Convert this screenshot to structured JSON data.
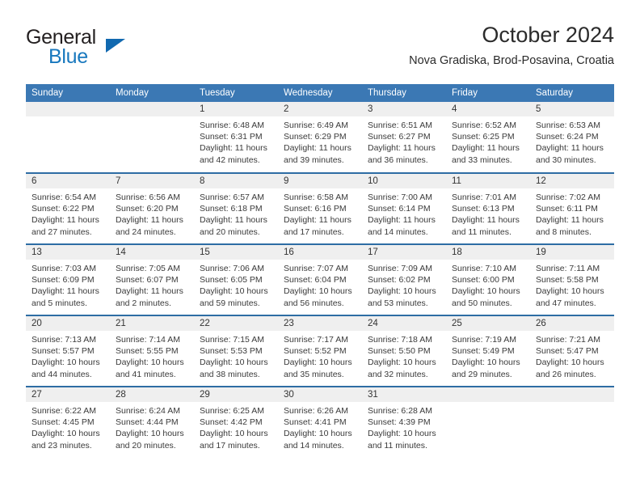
{
  "brand": {
    "line1": "General",
    "line2": "Blue",
    "triangle_icon": "triangle-icon"
  },
  "header": {
    "title": "October 2024",
    "subtitle": "Nova Gradiska, Brod-Posavina, Croatia"
  },
  "colors": {
    "header_blue": "#3b78b4",
    "rule_blue": "#2e6da4",
    "daynum_bg": "#efefef",
    "brand_blue": "#1878be",
    "text": "#333333"
  },
  "weekday_headers": [
    "Sunday",
    "Monday",
    "Tuesday",
    "Wednesday",
    "Thursday",
    "Friday",
    "Saturday"
  ],
  "weeks": [
    [
      {
        "day": "",
        "empty": true,
        "sunrise": "",
        "sunset": "",
        "daylight": ""
      },
      {
        "day": "",
        "empty": true,
        "sunrise": "",
        "sunset": "",
        "daylight": ""
      },
      {
        "day": "1",
        "sunrise": "Sunrise: 6:48 AM",
        "sunset": "Sunset: 6:31 PM",
        "daylight": "Daylight: 11 hours and 42 minutes."
      },
      {
        "day": "2",
        "sunrise": "Sunrise: 6:49 AM",
        "sunset": "Sunset: 6:29 PM",
        "daylight": "Daylight: 11 hours and 39 minutes."
      },
      {
        "day": "3",
        "sunrise": "Sunrise: 6:51 AM",
        "sunset": "Sunset: 6:27 PM",
        "daylight": "Daylight: 11 hours and 36 minutes."
      },
      {
        "day": "4",
        "sunrise": "Sunrise: 6:52 AM",
        "sunset": "Sunset: 6:25 PM",
        "daylight": "Daylight: 11 hours and 33 minutes."
      },
      {
        "day": "5",
        "sunrise": "Sunrise: 6:53 AM",
        "sunset": "Sunset: 6:24 PM",
        "daylight": "Daylight: 11 hours and 30 minutes."
      }
    ],
    [
      {
        "day": "6",
        "sunrise": "Sunrise: 6:54 AM",
        "sunset": "Sunset: 6:22 PM",
        "daylight": "Daylight: 11 hours and 27 minutes."
      },
      {
        "day": "7",
        "sunrise": "Sunrise: 6:56 AM",
        "sunset": "Sunset: 6:20 PM",
        "daylight": "Daylight: 11 hours and 24 minutes."
      },
      {
        "day": "8",
        "sunrise": "Sunrise: 6:57 AM",
        "sunset": "Sunset: 6:18 PM",
        "daylight": "Daylight: 11 hours and 20 minutes."
      },
      {
        "day": "9",
        "sunrise": "Sunrise: 6:58 AM",
        "sunset": "Sunset: 6:16 PM",
        "daylight": "Daylight: 11 hours and 17 minutes."
      },
      {
        "day": "10",
        "sunrise": "Sunrise: 7:00 AM",
        "sunset": "Sunset: 6:14 PM",
        "daylight": "Daylight: 11 hours and 14 minutes."
      },
      {
        "day": "11",
        "sunrise": "Sunrise: 7:01 AM",
        "sunset": "Sunset: 6:13 PM",
        "daylight": "Daylight: 11 hours and 11 minutes."
      },
      {
        "day": "12",
        "sunrise": "Sunrise: 7:02 AM",
        "sunset": "Sunset: 6:11 PM",
        "daylight": "Daylight: 11 hours and 8 minutes."
      }
    ],
    [
      {
        "day": "13",
        "sunrise": "Sunrise: 7:03 AM",
        "sunset": "Sunset: 6:09 PM",
        "daylight": "Daylight: 11 hours and 5 minutes."
      },
      {
        "day": "14",
        "sunrise": "Sunrise: 7:05 AM",
        "sunset": "Sunset: 6:07 PM",
        "daylight": "Daylight: 11 hours and 2 minutes."
      },
      {
        "day": "15",
        "sunrise": "Sunrise: 7:06 AM",
        "sunset": "Sunset: 6:05 PM",
        "daylight": "Daylight: 10 hours and 59 minutes."
      },
      {
        "day": "16",
        "sunrise": "Sunrise: 7:07 AM",
        "sunset": "Sunset: 6:04 PM",
        "daylight": "Daylight: 10 hours and 56 minutes."
      },
      {
        "day": "17",
        "sunrise": "Sunrise: 7:09 AM",
        "sunset": "Sunset: 6:02 PM",
        "daylight": "Daylight: 10 hours and 53 minutes."
      },
      {
        "day": "18",
        "sunrise": "Sunrise: 7:10 AM",
        "sunset": "Sunset: 6:00 PM",
        "daylight": "Daylight: 10 hours and 50 minutes."
      },
      {
        "day": "19",
        "sunrise": "Sunrise: 7:11 AM",
        "sunset": "Sunset: 5:58 PM",
        "daylight": "Daylight: 10 hours and 47 minutes."
      }
    ],
    [
      {
        "day": "20",
        "sunrise": "Sunrise: 7:13 AM",
        "sunset": "Sunset: 5:57 PM",
        "daylight": "Daylight: 10 hours and 44 minutes."
      },
      {
        "day": "21",
        "sunrise": "Sunrise: 7:14 AM",
        "sunset": "Sunset: 5:55 PM",
        "daylight": "Daylight: 10 hours and 41 minutes."
      },
      {
        "day": "22",
        "sunrise": "Sunrise: 7:15 AM",
        "sunset": "Sunset: 5:53 PM",
        "daylight": "Daylight: 10 hours and 38 minutes."
      },
      {
        "day": "23",
        "sunrise": "Sunrise: 7:17 AM",
        "sunset": "Sunset: 5:52 PM",
        "daylight": "Daylight: 10 hours and 35 minutes."
      },
      {
        "day": "24",
        "sunrise": "Sunrise: 7:18 AM",
        "sunset": "Sunset: 5:50 PM",
        "daylight": "Daylight: 10 hours and 32 minutes."
      },
      {
        "day": "25",
        "sunrise": "Sunrise: 7:19 AM",
        "sunset": "Sunset: 5:49 PM",
        "daylight": "Daylight: 10 hours and 29 minutes."
      },
      {
        "day": "26",
        "sunrise": "Sunrise: 7:21 AM",
        "sunset": "Sunset: 5:47 PM",
        "daylight": "Daylight: 10 hours and 26 minutes."
      }
    ],
    [
      {
        "day": "27",
        "sunrise": "Sunrise: 6:22 AM",
        "sunset": "Sunset: 4:45 PM",
        "daylight": "Daylight: 10 hours and 23 minutes."
      },
      {
        "day": "28",
        "sunrise": "Sunrise: 6:24 AM",
        "sunset": "Sunset: 4:44 PM",
        "daylight": "Daylight: 10 hours and 20 minutes."
      },
      {
        "day": "29",
        "sunrise": "Sunrise: 6:25 AM",
        "sunset": "Sunset: 4:42 PM",
        "daylight": "Daylight: 10 hours and 17 minutes."
      },
      {
        "day": "30",
        "sunrise": "Sunrise: 6:26 AM",
        "sunset": "Sunset: 4:41 PM",
        "daylight": "Daylight: 10 hours and 14 minutes."
      },
      {
        "day": "31",
        "sunrise": "Sunrise: 6:28 AM",
        "sunset": "Sunset: 4:39 PM",
        "daylight": "Daylight: 10 hours and 11 minutes."
      },
      {
        "day": "",
        "empty": true,
        "sunrise": "",
        "sunset": "",
        "daylight": ""
      },
      {
        "day": "",
        "empty": true,
        "sunrise": "",
        "sunset": "",
        "daylight": ""
      }
    ]
  ]
}
